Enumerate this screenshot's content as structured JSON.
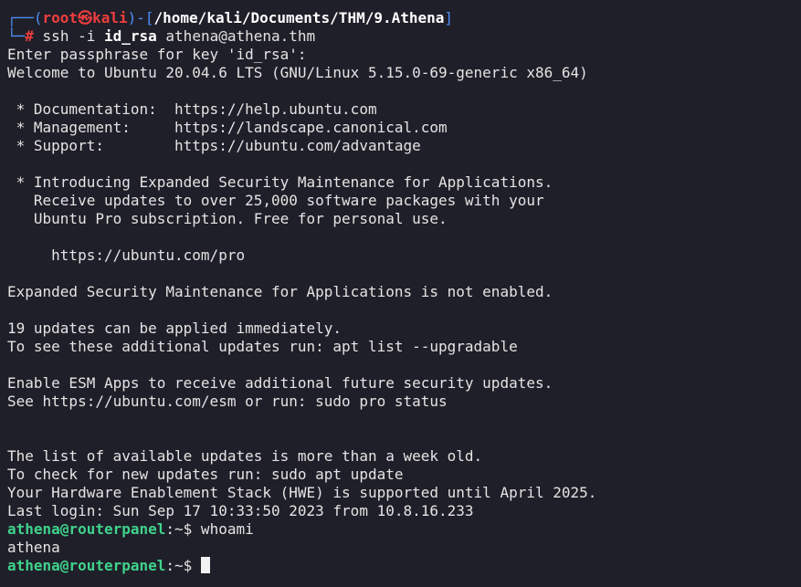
{
  "prompt_kali": {
    "open": "┌──(",
    "user": "root",
    "skull": "㉿",
    "host": "kali",
    "close": ")-[",
    "path": "/home/kali/Documents/THM/9.Athena",
    "end": "]",
    "line2_prefix": "└─",
    "hash": "#",
    "cmd_ssh": "ssh -i ",
    "cmd_key": "id_rsa",
    "cmd_target": " athena@athena.thm"
  },
  "output_lines": [
    "Enter passphrase for key 'id_rsa':",
    "Welcome to Ubuntu 20.04.6 LTS (GNU/Linux 5.15.0-69-generic x86_64)",
    "",
    " * Documentation:  https://help.ubuntu.com",
    " * Management:     https://landscape.canonical.com",
    " * Support:        https://ubuntu.com/advantage",
    "",
    " * Introducing Expanded Security Maintenance for Applications.",
    "   Receive updates to over 25,000 software packages with your",
    "   Ubuntu Pro subscription. Free for personal use.",
    "",
    "     https://ubuntu.com/pro",
    "",
    "Expanded Security Maintenance for Applications is not enabled.",
    "",
    "19 updates can be applied immediately.",
    "To see these additional updates run: apt list --upgradable",
    "",
    "Enable ESM Apps to receive additional future security updates.",
    "See https://ubuntu.com/esm or run: sudo pro status",
    "",
    "",
    "The list of available updates is more than a week old.",
    "To check for new updates run: sudo apt update",
    "Your Hardware Enablement Stack (HWE) is supported until April 2025.",
    "Last login: Sun Sep 17 10:33:50 2023 from 10.8.16.233"
  ],
  "remote_prompt": {
    "user_host": "athena@routerpanel",
    "sep": ":~$",
    "cmd1": " whoami",
    "result1": "athena",
    "cmd2": " "
  },
  "colors": {
    "background": "#1f1f29",
    "text": "#e4e4e4",
    "prompt_blue": "#4f8ef7",
    "root_red": "#ef3e3e",
    "remote_green": "#3fd28b"
  }
}
